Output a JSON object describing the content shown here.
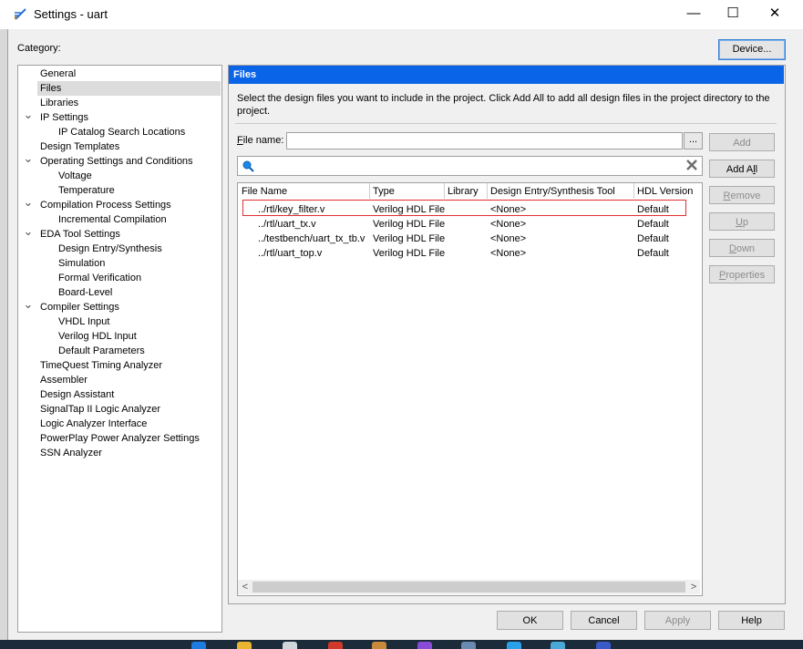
{
  "window": {
    "title": "Settings - uart",
    "minimize_glyph": "—",
    "maximize_glyph": "☐",
    "close_glyph": "✕"
  },
  "category_label": "Category:",
  "device_button": "Device...",
  "tree": [
    {
      "label": "General"
    },
    {
      "label": "Files",
      "selected": true
    },
    {
      "label": "Libraries"
    },
    {
      "label": "IP Settings",
      "expanded": true
    },
    {
      "label": "IP Catalog Search Locations"
    },
    {
      "label": "Design Templates"
    },
    {
      "label": "Operating Settings and Conditions",
      "expanded": true
    },
    {
      "label": "Voltage"
    },
    {
      "label": "Temperature"
    },
    {
      "label": "Compilation Process Settings",
      "expanded": true
    },
    {
      "label": "Incremental Compilation"
    },
    {
      "label": "EDA Tool Settings",
      "expanded": true
    },
    {
      "label": "Design Entry/Synthesis"
    },
    {
      "label": "Simulation"
    },
    {
      "label": "Formal Verification"
    },
    {
      "label": "Board-Level"
    },
    {
      "label": "Compiler Settings",
      "expanded": true
    },
    {
      "label": "VHDL Input"
    },
    {
      "label": "Verilog HDL Input"
    },
    {
      "label": "Default Parameters"
    },
    {
      "label": "TimeQuest Timing Analyzer"
    },
    {
      "label": "Assembler"
    },
    {
      "label": "Design Assistant"
    },
    {
      "label": "SignalTap II Logic Analyzer"
    },
    {
      "label": "Logic Analyzer Interface"
    },
    {
      "label": "PowerPlay Power Analyzer Settings"
    },
    {
      "label": "SSN Analyzer"
    }
  ],
  "panel": {
    "header": "Files",
    "description": "Select the design files you want to include in the project. Click Add All to add all design files in the project directory to the project.",
    "file_name_label_underlined": "F",
    "file_name_label_rest": "ile name:",
    "file_name_value": "",
    "browse_label": "...",
    "search_value": ""
  },
  "table": {
    "columns": [
      "File Name",
      "Type",
      "Library",
      "Design Entry/Synthesis Tool",
      "HDL Version"
    ],
    "rows": [
      [
        "../rtl/key_filter.v",
        "Verilog HDL File",
        "",
        "<None>",
        "Default"
      ],
      [
        "../rtl/uart_tx.v",
        "Verilog HDL File",
        "",
        "<None>",
        "Default"
      ],
      [
        "../testbench/uart_tx_tb.v",
        "Verilog HDL File",
        "",
        "<None>",
        "Default"
      ],
      [
        "../rtl/uart_top.v",
        "Verilog HDL File",
        "",
        "<None>",
        "Default"
      ]
    ]
  },
  "side_buttons": {
    "add": "Add",
    "add_all_pre": "Add A",
    "add_all_ul": "l",
    "add_all_post": "l",
    "remove_ul": "R",
    "remove_rest": "emove",
    "up_ul": "U",
    "up_rest": "p",
    "down_ul": "D",
    "down_rest": "own",
    "properties_ul": "P",
    "properties_rest": "roperties"
  },
  "bottom_buttons": {
    "ok": "OK",
    "cancel": "Cancel",
    "apply": "Apply",
    "help": "Help"
  },
  "colors": {
    "header_blue": "#0a64e8",
    "highlight_red": "#e03030",
    "selected_row": "#dcdcdc"
  }
}
